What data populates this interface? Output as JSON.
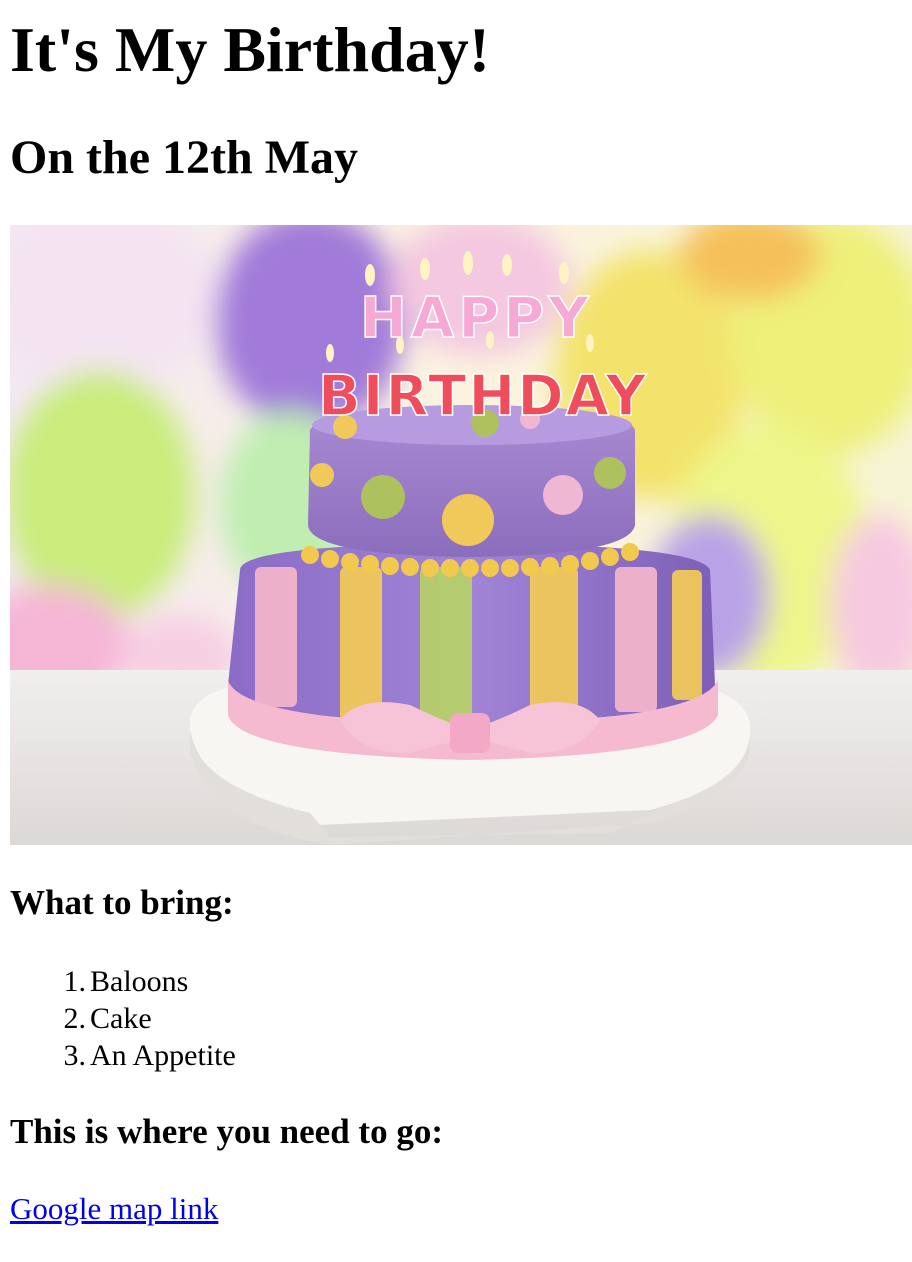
{
  "page": {
    "title": "It's My Birthday!",
    "date_heading": "On the 12th May"
  },
  "hero_image": {
    "alt": "Birthday cake",
    "candle_text_line1": "HAPPY",
    "candle_text_line2": "BIRTHDAY"
  },
  "bring": {
    "heading": "What to bring:",
    "items": [
      {
        "num": "1.",
        "label": "Baloons"
      },
      {
        "num": "2.",
        "label": "Cake"
      },
      {
        "num": "3.",
        "label": "An Appetite"
      }
    ]
  },
  "directions": {
    "heading": "This is where you need to go:",
    "link_label": "Google map link"
  },
  "colors": {
    "link": "#0000ee",
    "text": "#000000"
  }
}
